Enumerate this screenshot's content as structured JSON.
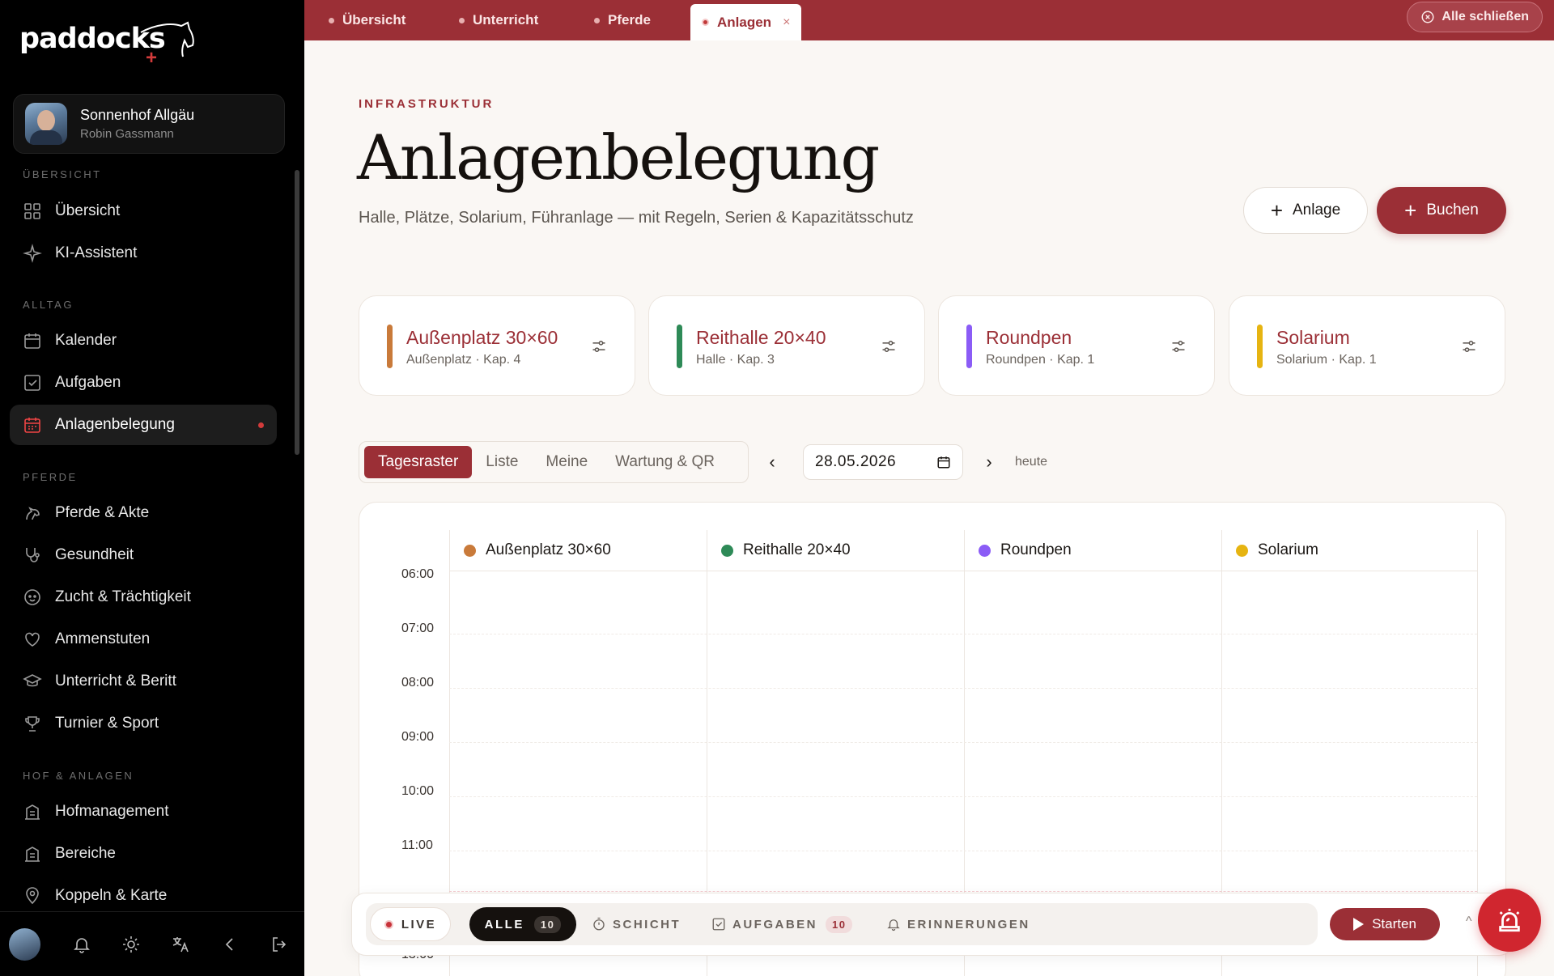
{
  "app": {
    "logo": "paddocks"
  },
  "profile": {
    "name": "Sonnenhof Allgäu",
    "user": "Robin Gassmann"
  },
  "sidebar": {
    "sections": [
      {
        "title": "ÜBERSICHT",
        "items": [
          {
            "label": "Übersicht",
            "icon": "grid-icon"
          },
          {
            "label": "KI-Assistent",
            "icon": "sparkle-icon"
          }
        ]
      },
      {
        "title": "ALLTAG",
        "items": [
          {
            "label": "Kalender",
            "icon": "calendar-icon"
          },
          {
            "label": "Aufgaben",
            "icon": "checkbox-icon"
          },
          {
            "label": "Anlagenbelegung",
            "icon": "calendar-grid-icon",
            "active": true
          }
        ]
      },
      {
        "title": "PFERDE",
        "items": [
          {
            "label": "Pferde & Akte",
            "icon": "horse-icon"
          },
          {
            "label": "Gesundheit",
            "icon": "stethoscope-icon"
          },
          {
            "label": "Zucht & Trächtigkeit",
            "icon": "baby-icon"
          },
          {
            "label": "Ammenstuten",
            "icon": "heart-icon"
          },
          {
            "label": "Unterricht & Beritt",
            "icon": "graduation-cap-icon"
          },
          {
            "label": "Turnier & Sport",
            "icon": "trophy-icon"
          }
        ]
      },
      {
        "title": "HOF & ANLAGEN",
        "items": [
          {
            "label": "Hofmanagement",
            "icon": "building-icon"
          },
          {
            "label": "Bereiche",
            "icon": "building-icon"
          },
          {
            "label": "Koppeln & Karte",
            "icon": "map-pin-icon"
          }
        ]
      }
    ]
  },
  "tabs": [
    {
      "label": "Übersicht"
    },
    {
      "label": "Unterricht"
    },
    {
      "label": "Pferde"
    },
    {
      "label": "Anlagen",
      "active": true
    }
  ],
  "tabbar": {
    "close_all": "Alle schließen",
    "close_glyph": "×"
  },
  "page": {
    "eyebrow": "INFRASTRUKTUR",
    "title": "Anlagenbelegung",
    "subtitle": "Halle, Plätze, Solarium, Führanlage — mit Regeln, Serien & Kapazitätsschutz",
    "btn_anlage": "Anlage",
    "btn_buchen": "Buchen"
  },
  "facilities": [
    {
      "name": "Außenplatz 30×60",
      "meta": "Außenplatz · Kap. 4",
      "color": "#c97a3a"
    },
    {
      "name": "Reithalle 20×40",
      "meta": "Halle · Kap. 3",
      "color": "#2e8a57"
    },
    {
      "name": "Roundpen",
      "meta": "Roundpen · Kap. 1",
      "color": "#8b5cf6"
    },
    {
      "name": "Solarium",
      "meta": "Solarium · Kap. 1",
      "color": "#e6b411"
    }
  ],
  "view_tabs": [
    "Tagesraster",
    "Liste",
    "Meine",
    "Wartung & QR"
  ],
  "date": {
    "value": "28.05.2026",
    "today": "heute",
    "prev": "‹",
    "next": "›"
  },
  "schedule": {
    "times": [
      "06:00",
      "07:00",
      "08:00",
      "09:00",
      "10:00",
      "11:00",
      "13:00"
    ]
  },
  "bottombar": {
    "live": "LIVE",
    "alle": "ALLE",
    "alle_count": "10",
    "schicht": "SCHICHT",
    "aufgaben": "AUFGABEN",
    "aufgaben_count": "10",
    "erinnerungen": "ERINNERUNGEN",
    "starten": "Starten",
    "caret": "^"
  }
}
